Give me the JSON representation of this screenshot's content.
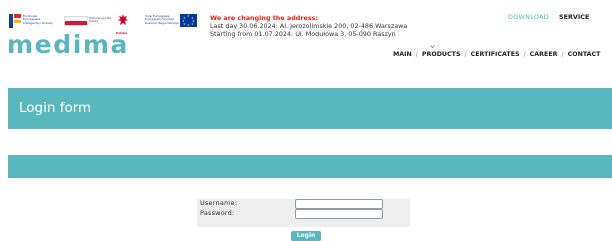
{
  "header": {
    "brand": "medima",
    "logos": {
      "fe": {
        "line1": "Fundusze",
        "line2": "Europejskie",
        "line3": "Inteligentny Rozwój"
      },
      "pl_flag": {
        "line1": "Rzeczpospolita",
        "line2": "Polska"
      },
      "emblem": {
        "label": "Polska"
      },
      "ue": {
        "line1": "Unia Europejska",
        "line2": "Europejski Fundusz",
        "line3": "Rozwoju Regionalnego"
      }
    },
    "notice": {
      "headline": "We are changing the address:",
      "line1": "Last day 30.06.2024: Al. Jerozolimskie 200, 02-486 Warszawa",
      "line2": "Starting from 01.07.2024: Ul. Modułowa 3, 05-090 Raszyn"
    },
    "top_links": {
      "download": "DOWNLOAD",
      "service": "SERVICE"
    },
    "nav": [
      "MAIN",
      "PRODUCTS",
      "CERTIFICATES",
      "CAREER",
      "CONTACT"
    ],
    "nav_separator": "/"
  },
  "page": {
    "title": "Login form"
  },
  "form": {
    "username_label": "Username:",
    "username_value": "",
    "password_label": "Password:",
    "password_value": "",
    "submit_label": "Login"
  },
  "colors": {
    "accent": "#5ab7be",
    "notice_red": "#e2231a",
    "form_bg": "#eeeeee"
  }
}
